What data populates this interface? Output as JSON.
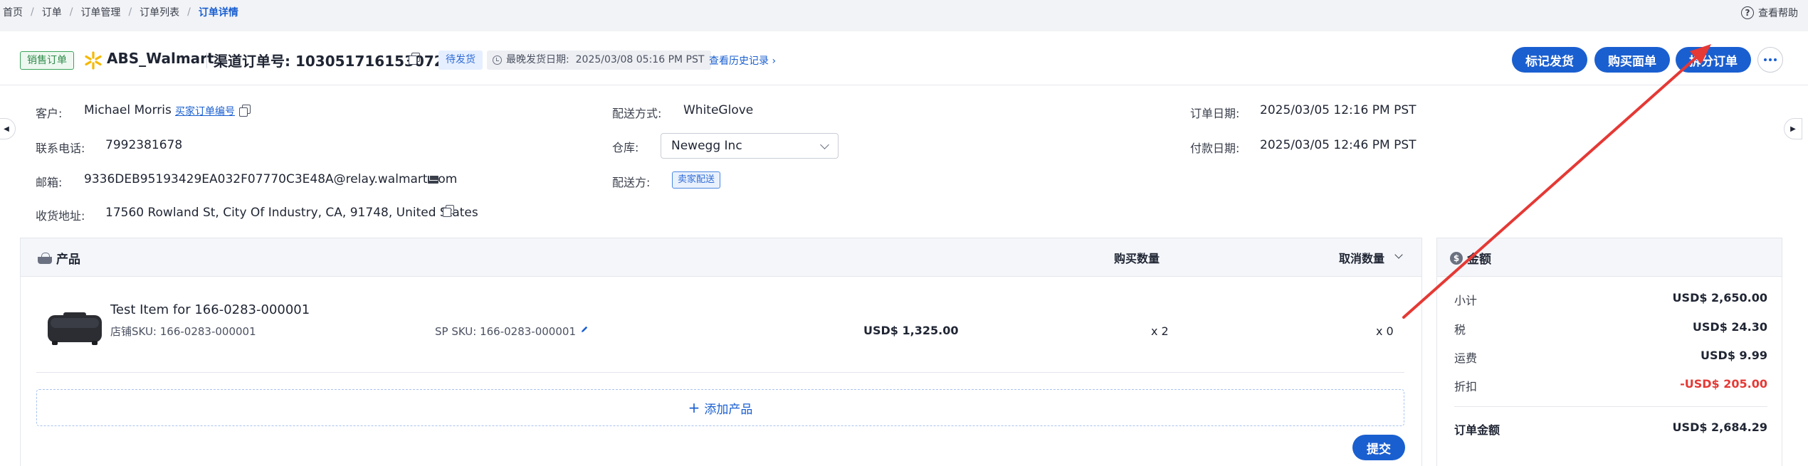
{
  "breadcrumb": [
    "首页",
    "订单",
    "订单管理",
    "订单列表",
    "订单详情"
  ],
  "help_label": "查看帮助",
  "header": {
    "sale_tag": "销售订单",
    "shop_name": "ABS_Walmart",
    "order_label": "渠道订单号:",
    "order_no": "103051716153072 20",
    "status_tag": "待发货",
    "latest_ship_label": "最晚发货日期:",
    "latest_ship_date": "2025/03/08 05:16 PM PST",
    "history_link": "查看历史记录 ›"
  },
  "actions": {
    "mark_shipped": "标记发货",
    "buy_label": "购买面单",
    "split_order": "拆分订单"
  },
  "details": {
    "customer_label": "客户:",
    "customer": "Michael Morris",
    "buyer_order_link": "买家订单编号",
    "phone_label": "联系电话:",
    "phone": "7992381678",
    "email_label": "邮箱:",
    "email": "9336DEB95193429EA032F07770C3E48A@relay.walmart.com",
    "address_label": "收货地址:",
    "address": "17560 Rowland St, City Of Industry, CA, 91748, United States",
    "ship_method_label": "配送方式:",
    "ship_method": "WhiteGlove",
    "warehouse_label": "仓库:",
    "warehouse": "Newegg Inc",
    "shipper_label": "配送方:",
    "shipper": "卖家配送",
    "order_date_label": "订单日期:",
    "order_date": "2025/03/05 12:16 PM PST",
    "pay_date_label": "付款日期:",
    "pay_date": "2025/03/05 12:46 PM PST"
  },
  "products": {
    "title": "产品",
    "qty_header": "购买数量",
    "cancel_header": "取消数量",
    "items": [
      {
        "name": "Test Item for 166-0283-000001",
        "store_sku": "店铺SKU: 166-0283-000001",
        "sp_sku": "SP SKU: 166-0283-000001",
        "price": "USD$ 1,325.00",
        "qty": "x 2",
        "cancel_qty": "x 0"
      }
    ],
    "add_label": "添加产品",
    "submit_label": "提交"
  },
  "amount": {
    "title": "金额",
    "rows": [
      {
        "label": "小计",
        "value": "USD$ 2,650.00"
      },
      {
        "label": "税",
        "value": "USD$ 24.30"
      },
      {
        "label": "运费",
        "value": "USD$ 9.99"
      },
      {
        "label": "折扣",
        "value": "-USD$ 205.00"
      }
    ],
    "total_label": "订单金额",
    "total_value": "USD$ 2,684.29"
  },
  "colors": {
    "primary": "#1a5fd0",
    "annotation": "#e53935",
    "negative": "#e53935",
    "walmart_spark": "#f5b800"
  }
}
